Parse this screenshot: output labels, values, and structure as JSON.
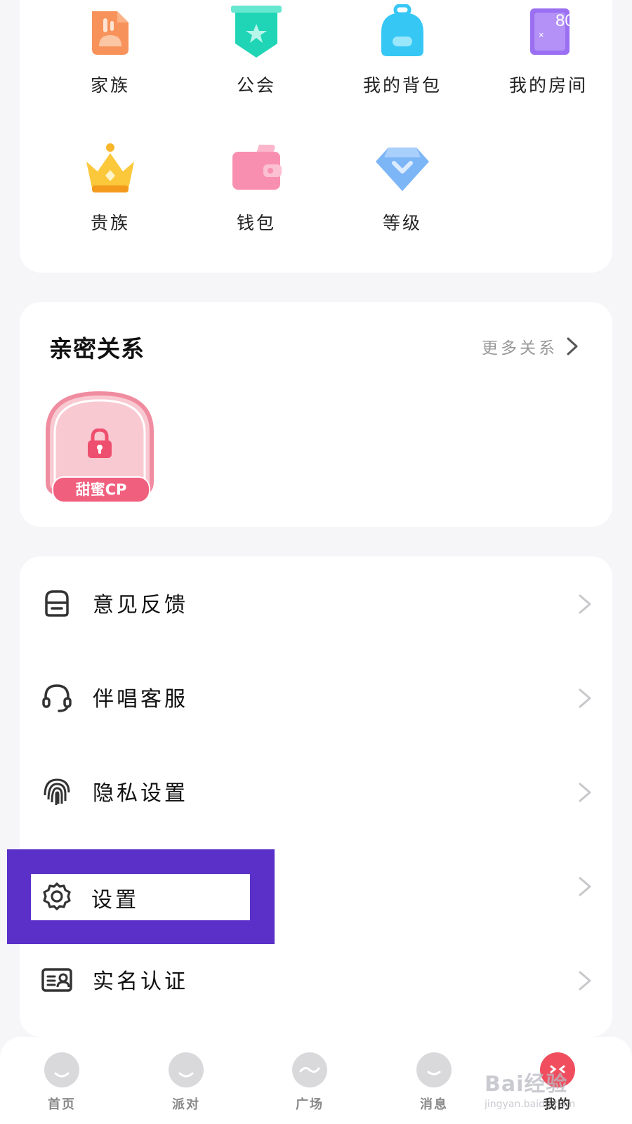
{
  "features": [
    {
      "label": "家族",
      "icon": "family-icon",
      "color": "#f7935a"
    },
    {
      "label": "公会",
      "icon": "guild-badge-icon",
      "color": "#1fd5b6"
    },
    {
      "label": "我的背包",
      "icon": "backpack-icon",
      "color": "#36c7f5"
    },
    {
      "label": "我的房间",
      "icon": "room-icon",
      "color": "#9b6ff2"
    },
    {
      "label": "贵族",
      "icon": "crown-icon",
      "color": "#f8b62a"
    },
    {
      "label": "钱包",
      "icon": "wallet-icon",
      "color": "#f98fb0"
    },
    {
      "label": "等级",
      "icon": "diamond-level-icon",
      "color": "#7db6f7"
    }
  ],
  "room_badge": "80",
  "intimacy": {
    "title": "亲密关系",
    "more_label": "更多关系",
    "slot_label": "甜蜜CP"
  },
  "menu": [
    {
      "label": "意见反馈",
      "icon": "feedback-icon"
    },
    {
      "label": "伴唱客服",
      "icon": "headset-icon"
    },
    {
      "label": "隐私设置",
      "icon": "fingerprint-icon"
    },
    {
      "label": "设置",
      "icon": "gear-icon"
    },
    {
      "label": "实名认证",
      "icon": "id-card-icon"
    }
  ],
  "tabs": [
    {
      "label": "首页"
    },
    {
      "label": "派对"
    },
    {
      "label": "广场"
    },
    {
      "label": "消息"
    },
    {
      "label": "我的"
    }
  ],
  "watermark": {
    "line1": "Bai经验",
    "line2": "jingyan.baidu.com"
  },
  "colors": {
    "highlight": "#5a30c8",
    "accent_pink": "#f0607e"
  }
}
